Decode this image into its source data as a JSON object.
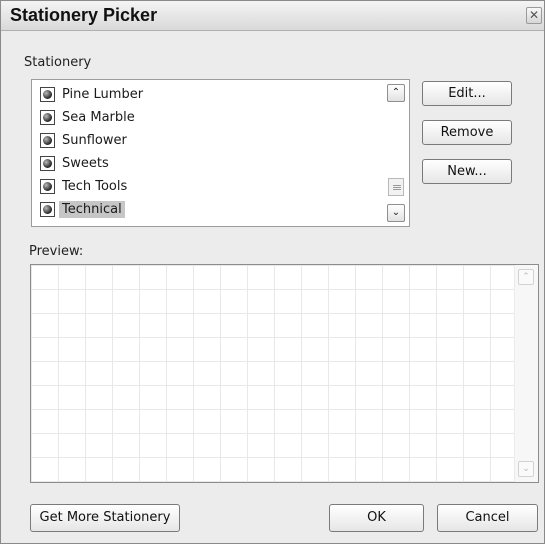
{
  "window": {
    "title": "Stationery Picker",
    "close_glyph": "✕"
  },
  "stationery": {
    "label": "Stationery",
    "items": [
      {
        "label": "Pine Lumber",
        "icon": "stationery-file-icon"
      },
      {
        "label": "Sea Marble",
        "icon": "stationery-file-icon"
      },
      {
        "label": "Sunflower",
        "icon": "stationery-file-icon"
      },
      {
        "label": "Sweets",
        "icon": "stationery-file-icon"
      },
      {
        "label": "Tech Tools",
        "icon": "stationery-file-icon"
      },
      {
        "label": "Technical",
        "icon": "stationery-file-icon",
        "selected": true
      }
    ],
    "scroll_up_glyph": "⌃",
    "scroll_down_glyph": "⌄"
  },
  "actions": {
    "edit_label": "Edit...",
    "remove_label": "Remove",
    "new_label": "New..."
  },
  "preview": {
    "label": "Preview:",
    "scroll_up_glyph": "⌃",
    "scroll_down_glyph": "⌄"
  },
  "footer": {
    "get_more_label": "Get More Stationery",
    "ok_label": "OK",
    "cancel_label": "Cancel"
  },
  "colors": {
    "dialog_bg": "#ececec",
    "selection_bg": "#c6c6c6",
    "grid_line": "#e8e8e8"
  }
}
